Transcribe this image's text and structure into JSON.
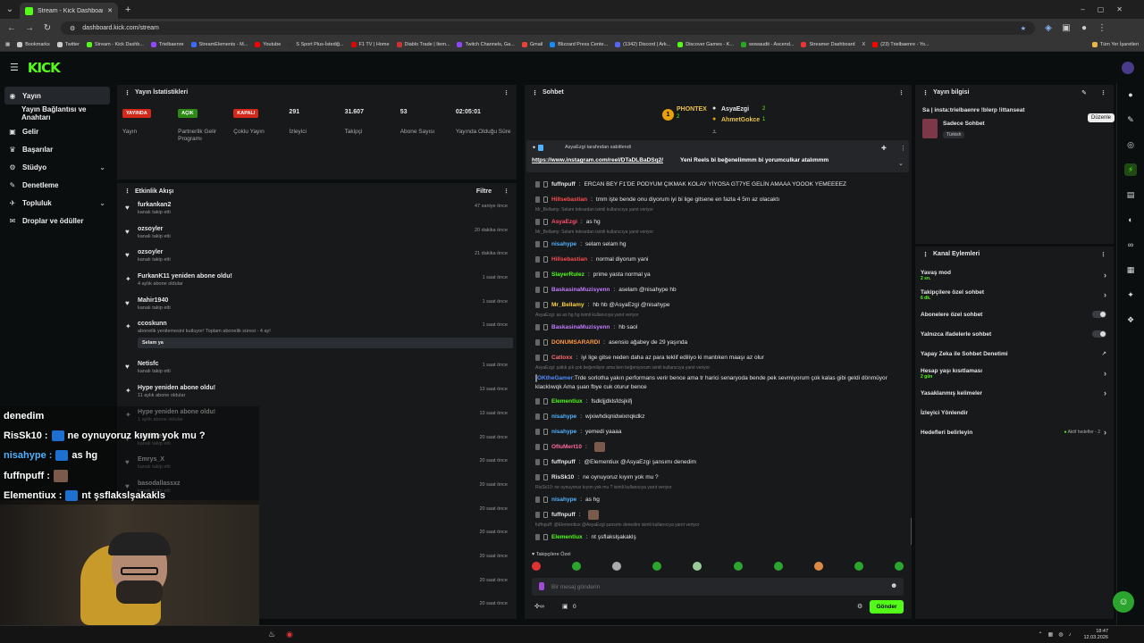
{
  "browser": {
    "tab_title": "Stream - Kick Dashboard",
    "url": "dashboard.kick.com/stream",
    "bookmarks": [
      "Bookmarks",
      "Twitter",
      "Stream - Kick Dashb...",
      "Trielbaenre",
      "StreamElements - M...",
      "Youtube",
      "S Sport Plus-İstediğ...",
      "F1 TV | Home",
      "Diablo Trade | Item...",
      "Twitch Channels, Ga...",
      "Gmail",
      "Blizzard Press Cente...",
      "(1342) Discord | Ark...",
      "Discover Games - K...",
      "wowaudit - Ascend...",
      "Streamer Dashboard",
      "X",
      "(23) Trielbaenre - Yo..."
    ],
    "all_bookmarks": "Tüm Yer İşaretleri"
  },
  "sidebar": {
    "items": [
      {
        "label": "Yayın",
        "icon": "broadcast-icon"
      },
      {
        "label": "Yayın Bağlantısı ve Anahtarı",
        "icon": "link-icon"
      },
      {
        "label": "Gelir",
        "icon": "money-icon"
      },
      {
        "label": "Başarılar",
        "icon": "trophy-icon"
      },
      {
        "label": "Stüdyo",
        "icon": "studio-icon"
      },
      {
        "label": "Denetleme",
        "icon": "moderation-icon"
      },
      {
        "label": "Topluluk",
        "icon": "community-icon"
      },
      {
        "label": "Droplar ve ödüller",
        "icon": "gift-icon"
      }
    ]
  },
  "stats": {
    "title": "Yayın İstatistikleri",
    "items": [
      {
        "value": "YAYINDA",
        "label": "Yayın",
        "badge": "red"
      },
      {
        "value": "AÇIK",
        "label": "Partnerlik Gelir Programı",
        "badge": "green"
      },
      {
        "value": "KAPALI",
        "label": "Çoklu Yayın",
        "badge": "red"
      },
      {
        "value": "291",
        "label": "İzleyici"
      },
      {
        "value": "31.607",
        "label": "Takipçi"
      },
      {
        "value": "53",
        "label": "Abone Sayısı"
      },
      {
        "value": "02:05:01",
        "label": "Yayında Olduğu Süre"
      }
    ]
  },
  "activity": {
    "title": "Etkinlik Akışı",
    "filter": "Filtre",
    "items": [
      {
        "name": "furkankan2",
        "sub": "kanalı takip etti",
        "time": "47 saniye önce",
        "icon": "heart"
      },
      {
        "name": "ozsoyler",
        "sub": "kanalı takip etti",
        "time": "20 dakika önce",
        "icon": "heart"
      },
      {
        "name": "ozsoyler",
        "sub": "kanalı takip etti",
        "time": "21 dakika önce",
        "icon": "heart"
      },
      {
        "name": "FurkanK11 yeniden abone oldu!",
        "sub": "4 aylık abone oldular",
        "time": "1 saat önce",
        "icon": "star"
      },
      {
        "name": "Mahir1940",
        "sub": "kanalı takip etti",
        "time": "1 saat önce",
        "icon": "heart"
      },
      {
        "name": "ccoskunn",
        "sub": "abonelik yenilemesini kutluyor! Toplam abonelik süresi - 4 ay!",
        "time": "1 saat önce",
        "icon": "star",
        "message": "Selam ya"
      },
      {
        "name": "Netisfc",
        "sub": "kanalı takip etti",
        "time": "1 saat önce",
        "icon": "heart"
      },
      {
        "name": "Hype yeniden abone oldu!",
        "sub": "11 aylık abone oldular",
        "time": "13 saat önce",
        "icon": "star"
      },
      {
        "name": "Hype yeniden abone oldu!",
        "sub": "1 aylık abone oldular",
        "time": "13 saat önce",
        "icon": "star"
      },
      {
        "name": "Heyfaces",
        "sub": "kanalı takip etti",
        "time": "20 saat önce",
        "icon": "heart"
      },
      {
        "name": "Emrys_X",
        "sub": "kanalı takip etti",
        "time": "20 saat önce",
        "icon": "heart"
      },
      {
        "name": "basodallassxz",
        "sub": "kanalı takip etti",
        "time": "20 saat önce",
        "icon": "heart"
      }
    ],
    "more_times": [
      "20 saat önce",
      "20 saat önce",
      "20 saat önce",
      "20 saat önce",
      "20 saat önce"
    ]
  },
  "chat": {
    "title": "Sohbet",
    "top_gifters": [
      {
        "rank": "1",
        "name": "PHONTEX",
        "count": "2"
      },
      {
        "rank": "",
        "name": "AsyaEzgi",
        "count": "2"
      },
      {
        "rank": "",
        "name": "AhmetGokce",
        "count": "1"
      }
    ],
    "pinned_by": "AsyaEzgi tarafından sabitlendi",
    "pinned_link": "https://www.instagram.com/reel/DTaDLBaDSq2/",
    "pinned_text": "Yeni Reels bi beğenelimmm bi yorumculkar atalımmm",
    "messages": [
      {
        "user": "fuffnpuff",
        "color": "#e7e7e7",
        "text": "ERCAN BEY F1'DE PODYUM ÇIKMAK KOLAY YİYOSA GT7YE GELİN AMAAA YOOOK YEMEEEEZ"
      },
      {
        "user": "Hillsebastian",
        "color": "#ff4d4d",
        "text": "tmm işte bende onu diyorum iyi bi lige gitsene en fazla 4 5m az olacaktı"
      },
      {
        "reply": "Mr_Bellamy: Selam tekrardan isimli kullanıcıya yanıt veriyor"
      },
      {
        "user": "AsyaEzgi",
        "color": "#ff4d6d",
        "text": "as hg"
      },
      {
        "reply": "Mr_Bellamy: Selam tekrardan isimli kullanıcıya yanıt veriyor"
      },
      {
        "user": "nisahype",
        "color": "#4fb3ff",
        "text": "selam selam hg"
      },
      {
        "user": "Hillsebastian",
        "color": "#ff4d4d",
        "text": "normal diyorum yani"
      },
      {
        "user": "SlayerRulez",
        "color": "#53fc18",
        "text": "prime yasta normal ya"
      },
      {
        "user": "BaskasinaMuzisyenn",
        "color": "#c07cff",
        "text": "aselam @nisahype hb"
      },
      {
        "user": "Mr_Bellamy",
        "color": "#ffd23f",
        "text": "hb hb @AsyaEzgi @nisahype"
      },
      {
        "reply": "AsyaEzgi: as as hg hg isimli kullanıcıya yanıt veriyor"
      },
      {
        "user": "BaskasinaMuzisyenn",
        "color": "#c07cff",
        "text": "hb saol"
      },
      {
        "user": "DONUMSARARDI",
        "color": "#ff9b3f",
        "text": "asensio ağabey de 29 yaşında"
      },
      {
        "user": "Catloxx",
        "color": "#ff6b6b",
        "text": "iyi lige gitse neden daha az para teklif ediliyo ki mantıken maaşı az olur"
      },
      {
        "reply": "AsyaEzgi: şatlık şık çok beğeniliyor ama ben beğeniyorum isimli kullanıcıya yanıt veriyor"
      },
      {
        "user": "OKtheGamer",
        "color": "#4f8dff",
        "text": "Trde sorlotha yakın performans verir bence ama tr harici senaryoda bende pek sevmiyorum çok kalas gibi geldi dönmüyor klacklıwqk Ama şuan fbye cuk oturur bence"
      },
      {
        "user": "Elementiux",
        "color": "#53fc18",
        "text": "fsdkljjdklsfdsjkifj"
      },
      {
        "user": "nisahype",
        "color": "#4fb3ff",
        "text": "wjxiwhdiqnidwixnqkdkz"
      },
      {
        "user": "nisahype",
        "color": "#4fb3ff",
        "text": "yemedi yaaaa"
      },
      {
        "user": "OfluMert10",
        "color": "#ff6b9d",
        "text": ""
      },
      {
        "user": "fuffnpuff",
        "color": "#e7e7e7",
        "text": "@Elementiux @AsyaEzgi şansımı denedim"
      },
      {
        "user": "RisSk10",
        "color": "#e7e7e7",
        "text": "ne oynuyoruz kıyım yok mu ?"
      },
      {
        "reply": "RisSk10: ne oynuyoruz kıyım yok mu ? isimli kullanıcıya yanıt veriyor"
      },
      {
        "user": "nisahype",
        "color": "#4fb3ff",
        "text": "as hg"
      },
      {
        "user": "fuffnpuff",
        "color": "#e7e7e7",
        "text": ""
      },
      {
        "reply": "fuffnpuff: @Elementiux @AsyaEzgi şansımı denedim isimli kullanıcıya yanıt veriyor"
      },
      {
        "user": "Elementiux",
        "color": "#53fc18",
        "text": "nt şsflakslşakaklş"
      }
    ],
    "followers_only": "Takipçilere Özel",
    "input_placeholder": "Bir mesaj gönderin",
    "counter": "0",
    "send": "Gönder"
  },
  "stream_info": {
    "title": "Yayın bilgisi",
    "stream_title": "Sa | insta:trielbaenre !blerp !ittanseat",
    "category": "Sadece Sohbet",
    "language": "Türkish",
    "tooltip": "Düzenle"
  },
  "channel_actions": {
    "title": "Kanal Eylemleri",
    "items": [
      {
        "label": "Yavaş mod",
        "sub": "2 sn.",
        "right": "chevron"
      },
      {
        "label": "Takipçilere özel sohbet",
        "sub": "6 dk.",
        "right": "chevron"
      },
      {
        "label": "Abonelere özel sohbet",
        "sub": "",
        "right": "toggle"
      },
      {
        "label": "Yalnızca ifadelerle sohbet",
        "sub": "",
        "right": "toggle"
      },
      {
        "label": "Yapay Zeka ile Sohbet Denetimi",
        "sub": "",
        "right": "external"
      },
      {
        "label": "Hesap yaşı kısıtlaması",
        "sub": "2 gün",
        "right": "chevron"
      },
      {
        "label": "Yasaklanmış kelimeler",
        "sub": "",
        "right": "chevron"
      },
      {
        "label": "İzleyici Yönlendir",
        "sub": "",
        "right": ""
      },
      {
        "label": "Hedefleri belirleyin",
        "sub": "",
        "right": "goals",
        "extra": "Aktif hedefler - 2"
      }
    ]
  },
  "overlay_chat": [
    {
      "user": "",
      "text": "denedim"
    },
    {
      "user": "RisSk10 :",
      "text": "ne oynuyoruz kıyım yok mu ?"
    },
    {
      "user": "nisahype :",
      "text": "as hg"
    },
    {
      "user": "fuffnpuff :",
      "text": ""
    },
    {
      "user": "Elementiux :",
      "text": "nt şsflakslşakakls"
    }
  ],
  "clock": {
    "time": "18:47",
    "date": "12.03.2026"
  },
  "colors": {
    "brand": "#53fc18",
    "panel": "#18191b",
    "bg": "#0b0e0f",
    "live": "#d4281b"
  }
}
